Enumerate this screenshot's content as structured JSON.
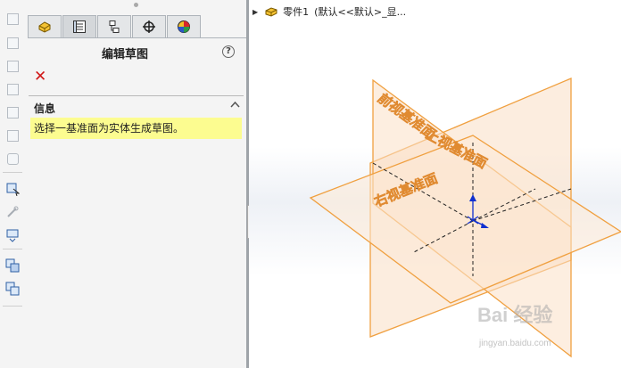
{
  "panel": {
    "title": "编辑草图",
    "help_symbol": "?",
    "cancel_symbol": "✕",
    "section_title": "信息",
    "collapse_symbol": "⌃",
    "message": "选择一基准面为实体生成草图。"
  },
  "tabs": [
    {
      "icon": "feature-manager-icon"
    },
    {
      "icon": "property-manager-icon"
    },
    {
      "icon": "configuration-manager-icon"
    },
    {
      "icon": "dimxpert-manager-icon"
    },
    {
      "icon": "display-manager-icon"
    }
  ],
  "tree": {
    "part_name": "零件1",
    "config_text": "(默认<<默认>_显..."
  },
  "planes": {
    "front": "前视基准面",
    "top": "上视基准面",
    "right": "右视基准面"
  },
  "colors": {
    "plane_orange": "#f0a040",
    "plane_fill": "#fbe3cc",
    "origin_blue": "#1030d0",
    "message_yellow": "#fcfc90",
    "cancel_red": "#d01818"
  },
  "watermark": {
    "main": "Bai 经验",
    "sub": "jingyan.baidu.com"
  }
}
